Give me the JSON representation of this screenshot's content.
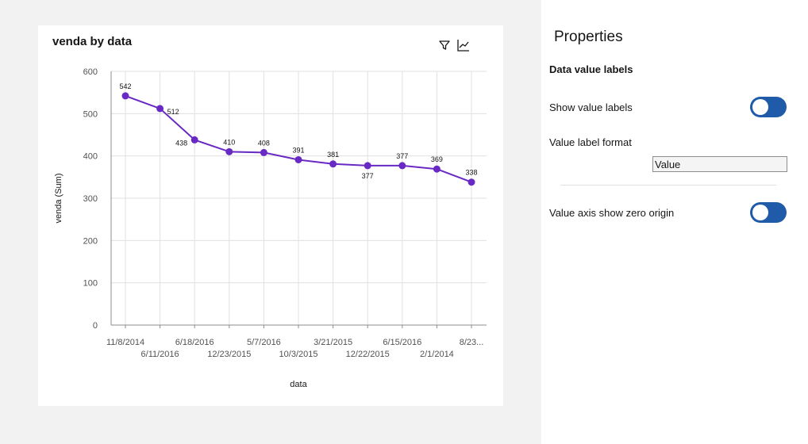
{
  "card": {
    "title": "venda by data",
    "icons": [
      "filter-icon",
      "line-chart-icon"
    ]
  },
  "chart_data": {
    "type": "line",
    "title": "venda by data",
    "xlabel": "data",
    "ylabel": "venda (Sum)",
    "categories": [
      "11/8/2014",
      "6/11/2016",
      "6/18/2016",
      "12/23/2015",
      "5/7/2016",
      "10/3/2015",
      "3/21/2015",
      "12/22/2015",
      "6/15/2016",
      "2/1/2014",
      "8/23..."
    ],
    "series": [
      {
        "values": [
          542,
          512,
          438,
          410,
          408,
          391,
          381,
          377,
          377,
          369,
          338
        ]
      }
    ],
    "ylim": [
      0,
      600
    ],
    "yticks": [
      0,
      100,
      200,
      300,
      400,
      500,
      600
    ],
    "grid": true,
    "color": "#6929c4"
  },
  "properties": {
    "title": "Properties",
    "section": "Data value labels",
    "show_value_labels": {
      "label": "Show value labels",
      "on": false
    },
    "value_label_format": {
      "label": "Value label format",
      "value": "Value"
    },
    "zero_origin": {
      "label": "Value axis show zero origin",
      "on": false
    }
  }
}
